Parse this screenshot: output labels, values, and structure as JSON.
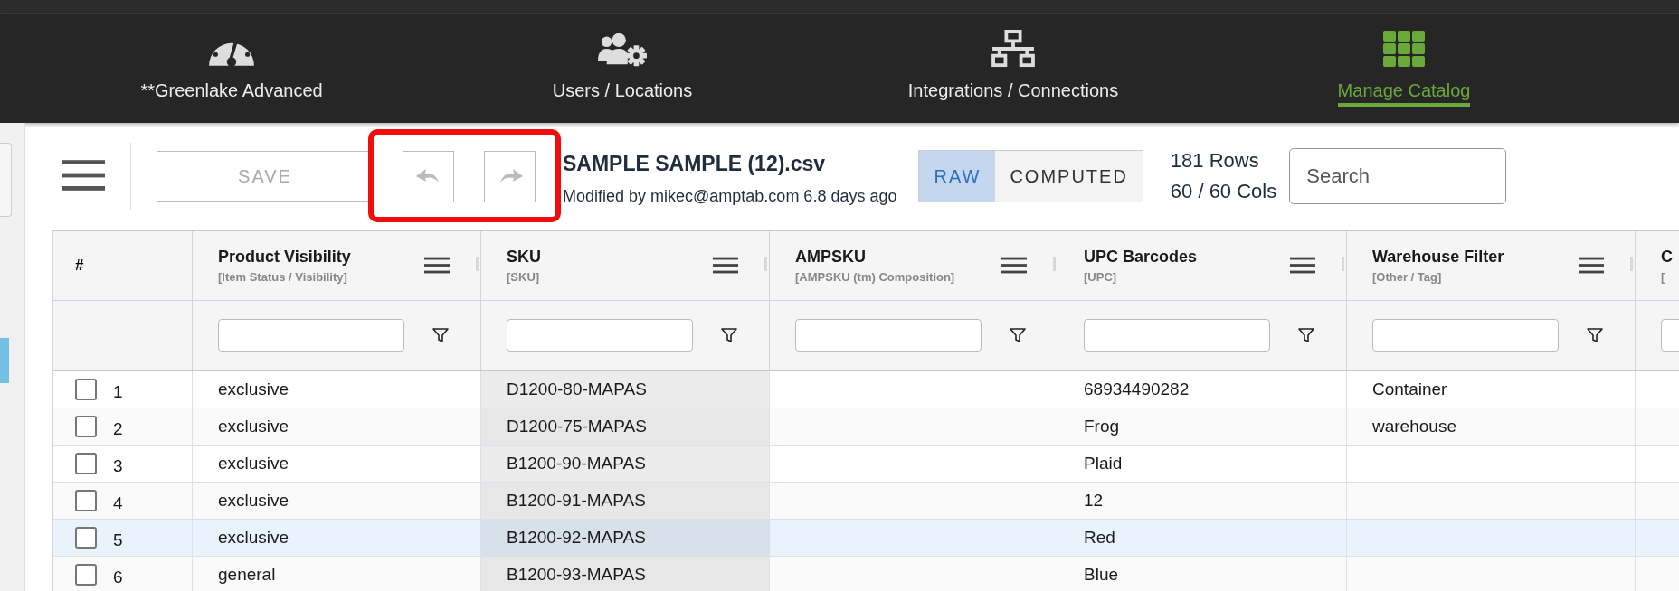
{
  "nav": [
    {
      "label": "**Greenlake Advanced",
      "selected": false
    },
    {
      "label": "Users / Locations",
      "selected": false
    },
    {
      "label": "Integrations / Connections",
      "selected": false
    },
    {
      "label": "Manage Catalog",
      "selected": true
    }
  ],
  "toolbar": {
    "save": {
      "label": "SAVE",
      "disabled": true
    },
    "undo": {
      "disabled": true
    },
    "redo": {
      "disabled": true
    },
    "file_title": "SAMPLE SAMPLE (12).csv",
    "modified": "Modified by mikec@amptab.com 6.8 days ago",
    "view_toggle": [
      {
        "label": "RAW",
        "selected": true
      },
      {
        "label": "COMPUTED",
        "selected": false
      }
    ],
    "row_count": "181 Rows",
    "col_count": "60 / 60 Cols",
    "search": {
      "placeholder": "Search"
    }
  },
  "table": {
    "columns": [
      {
        "kind": "index",
        "title": "#"
      },
      {
        "kind": "data",
        "title": "Product Visibility",
        "subtitle": "[Item Status / Visibility]",
        "shaded": false
      },
      {
        "kind": "data",
        "title": "SKU",
        "subtitle": "[SKU]",
        "shaded": true
      },
      {
        "kind": "data",
        "title": "AMPSKU",
        "subtitle": "[AMPSKU (tm) Composition]",
        "shaded": false
      },
      {
        "kind": "data",
        "title": "UPC Barcodes",
        "subtitle": "[UPC]",
        "shaded": false
      },
      {
        "kind": "data",
        "title": "Warehouse Filter",
        "subtitle": "[Other / Tag]",
        "shaded": false
      },
      {
        "kind": "data",
        "title": "C",
        "subtitle": "[",
        "shaded": false
      }
    ],
    "rows": [
      {
        "checked": false,
        "highlighted": false,
        "cells": [
          "1",
          "exclusive",
          "D1200-80-MAPAS",
          "",
          "68934490282",
          "Container"
        ]
      },
      {
        "checked": false,
        "highlighted": false,
        "cells": [
          "2",
          "exclusive",
          "D1200-75-MAPAS",
          "",
          "Frog",
          "warehouse"
        ]
      },
      {
        "checked": false,
        "highlighted": false,
        "cells": [
          "3",
          "exclusive",
          "B1200-90-MAPAS",
          "",
          "Plaid"
        ]
      },
      {
        "checked": false,
        "highlighted": false,
        "cells": [
          "4",
          "exclusive",
          "B1200-91-MAPAS",
          "",
          "12"
        ]
      },
      {
        "checked": false,
        "highlighted": true,
        "cells": [
          "5",
          "exclusive",
          "B1200-92-MAPAS",
          "",
          "Red"
        ]
      },
      {
        "checked": false,
        "highlighted": false,
        "cells": [
          "6",
          "general",
          "B1200-93-MAPAS",
          "",
          "Blue"
        ]
      }
    ]
  }
}
